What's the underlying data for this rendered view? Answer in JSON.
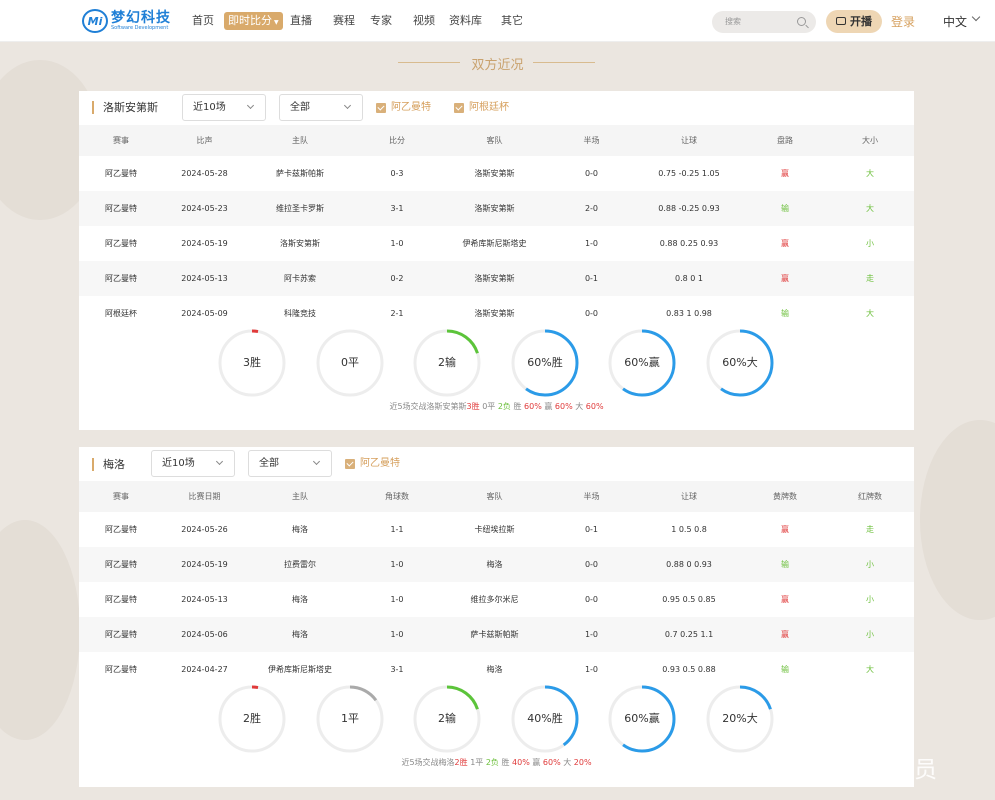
{
  "header": {
    "logo_text": "梦幻科技",
    "logo_sub": "Software Development",
    "logo_mark": "Mi",
    "nav": [
      "首页",
      "即时比分",
      "直播",
      "赛程",
      "专家",
      "视频",
      "资料库",
      "其它"
    ],
    "search_placeholder": "搜索",
    "live_label": "开播",
    "login_label": "登录",
    "lang_label": "中文"
  },
  "section_title": "双方近况",
  "panels": [
    {
      "team": "洛斯安第斯",
      "filter_count": "近10场",
      "filter_scope": "全部",
      "checks": [
        "阿乙曼特",
        "阿根廷杯"
      ],
      "columns": [
        "赛事",
        "比声",
        "主队",
        "比分",
        "客队",
        "半场",
        "让球",
        "盘路",
        "大小"
      ],
      "rows": [
        [
          "阿乙曼特",
          "2024-05-28",
          "萨卡兹斯帕斯",
          "0-3",
          "洛斯安第斯",
          "0-0",
          "0.75 -0.25 1.05",
          "赢",
          "大"
        ],
        [
          "阿乙曼特",
          "2024-05-23",
          "维拉圣卡罗斯",
          "3-1",
          "洛斯安第斯",
          "2-0",
          "0.88 -0.25 0.93",
          "输",
          "大"
        ],
        [
          "阿乙曼特",
          "2024-05-19",
          "洛斯安第斯",
          "1-0",
          "伊希库斯尼斯塔史",
          "1-0",
          "0.88 0.25 0.93",
          "赢",
          "小"
        ],
        [
          "阿乙曼特",
          "2024-05-13",
          "阿卡苏索",
          "0-2",
          "洛斯安第斯",
          "0-1",
          "0.8 0 1",
          "赢",
          "走"
        ],
        [
          "阿根廷杯",
          "2024-05-09",
          "科隆竞技",
          "2-1",
          "洛斯安第斯",
          "0-0",
          "0.83 1 0.98",
          "输",
          "大"
        ]
      ],
      "gauges": [
        {
          "label": "3胜",
          "value": 0.03,
          "color": "#e03a3a"
        },
        {
          "label": "0平",
          "value": 0,
          "color": "#aaaaaa"
        },
        {
          "label": "2输",
          "value": 0.2,
          "color": "#5cc43a"
        },
        {
          "label": "60%胜",
          "value": 0.6,
          "color": "#2b9be8"
        },
        {
          "label": "60%赢",
          "value": 0.6,
          "color": "#2b9be8"
        },
        {
          "label": "60%大",
          "value": 0.6,
          "color": "#2b9be8"
        }
      ],
      "summary": {
        "prefix": "近5场交战洛斯安第斯",
        "win": "3胜",
        "draw": "0平",
        "loss": "2负",
        "s1": "胜",
        "v1": "60%",
        "s2": "赢",
        "v2": "60%",
        "s3": "大",
        "v3": "60%"
      }
    },
    {
      "team": "梅洛",
      "filter_count": "近10场",
      "filter_scope": "全部",
      "checks": [
        "阿乙曼特"
      ],
      "columns": [
        "赛事",
        "比赛日期",
        "主队",
        "角球数",
        "客队",
        "半场",
        "让球",
        "黄牌数",
        "红牌数"
      ],
      "rows": [
        [
          "阿乙曼特",
          "2024-05-26",
          "梅洛",
          "1-1",
          "卡纽埃拉斯",
          "0-1",
          "1 0.5 0.8",
          "赢",
          "走"
        ],
        [
          "阿乙曼特",
          "2024-05-19",
          "拉费雷尔",
          "1-0",
          "梅洛",
          "0-0",
          "0.88 0 0.93",
          "输",
          "小"
        ],
        [
          "阿乙曼特",
          "2024-05-13",
          "梅洛",
          "1-0",
          "维拉多尔米尼",
          "0-0",
          "0.95 0.5 0.85",
          "赢",
          "小"
        ],
        [
          "阿乙曼特",
          "2024-05-06",
          "梅洛",
          "1-0",
          "萨卡兹斯帕斯",
          "1-0",
          "0.7 0.25 1.1",
          "赢",
          "小"
        ],
        [
          "阿乙曼特",
          "2024-04-27",
          "伊希库斯尼斯塔史",
          "3-1",
          "梅洛",
          "1-0",
          "0.93 0.5 0.88",
          "输",
          "大"
        ]
      ],
      "gauges": [
        {
          "label": "2胜",
          "value": 0.03,
          "color": "#e03a3a"
        },
        {
          "label": "1平",
          "value": 0.15,
          "color": "#aaaaaa"
        },
        {
          "label": "2输",
          "value": 0.2,
          "color": "#5cc43a"
        },
        {
          "label": "40%胜",
          "value": 0.4,
          "color": "#2b9be8"
        },
        {
          "label": "60%赢",
          "value": 0.6,
          "color": "#2b9be8"
        },
        {
          "label": "20%大",
          "value": 0.2,
          "color": "#2b9be8"
        }
      ],
      "summary": {
        "prefix": "近5场交战梅洛",
        "win": "2胜",
        "draw": "1平",
        "loss": "2负",
        "s1": "胜",
        "v1": "40%",
        "s2": "赢",
        "v2": "60%",
        "s3": "大",
        "v3": "20%"
      }
    }
  ],
  "watermark": "兔崽子程序员",
  "watermark_badge": "du"
}
